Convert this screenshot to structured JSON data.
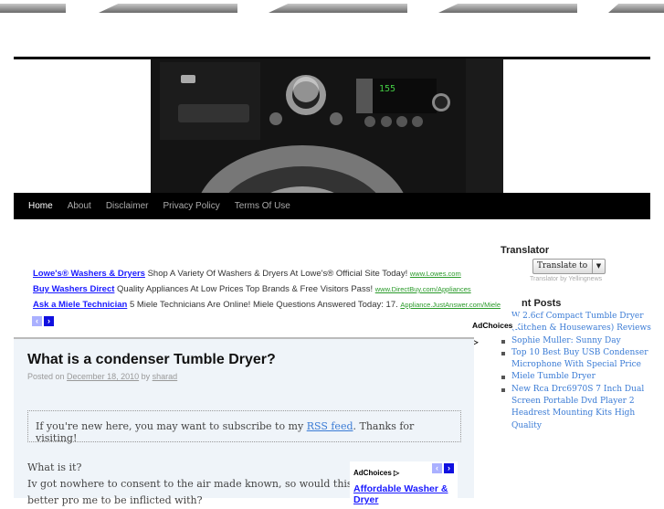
{
  "nav": {
    "items": [
      "Home",
      "About",
      "Disclaimer",
      "Privacy Policy",
      "Terms Of Use"
    ],
    "active": 0
  },
  "ads": [
    {
      "title": "Lowe's® Washers & Dryers",
      "text": "Shop A Variety Of Washers & Dryers At Lowe's® Official Site Today!",
      "url": "www.Lowes.com"
    },
    {
      "title": "Buy Washers Direct",
      "text": "Quality Appliances At Low Prices Top Brands & Free Visitors Pass!",
      "url": "www.DirectBuy.com/Appliances"
    },
    {
      "title": "Ask a Miele Technician",
      "text": "5 Miele Technicians Are Online! Miele Questions Answered Today: 17.",
      "url": "Appliance.JustAnswer.com/Miele"
    }
  ],
  "adchoices": "AdChoices ▷",
  "post": {
    "title": "What is a condenser Tumble Dryer?",
    "posted_on": "Posted on",
    "date": "December 18, 2010",
    "by": "by",
    "author": "sharad",
    "rss_pre": "If you're new here, you may want to subscribe to my",
    "rss_link": "RSS feed",
    "rss_post": ". Thanks for visiting!",
    "body": [
      "What is it?",
      "Iv got nowhere to consent to the air made known, so would this be",
      "better pro me to be inflicted with?"
    ]
  },
  "inline_ad": {
    "adchoices": "AdChoices ▷",
    "title": "Affordable Washer & Dryer"
  },
  "sidebar": {
    "translator_title": "Translator",
    "translate_select": "Translate to",
    "translator_credit": "Translator by Yellingnews",
    "recent_title": "Recent Posts",
    "recent_visible_title": "nt Posts",
    "recent": [
      "W 2.6cf Compact Tumble Dryer (Kitchen & Housewares) Reviews",
      "Sophie Muller: Sunny Day",
      "Top 10 Best Buy USB Condenser Microphone With Special Price",
      "Miele Tumble Dryer",
      "New Rca Drc6970S 7 Inch Dual Screen Portable Dvd Player 2 Headrest Mounting Kits High Quality"
    ]
  },
  "colors": {
    "link": "#3a7bd5",
    "ad_link": "#1a1aff",
    "ad_url": "#2a9a2a",
    "nav_bg": "#000000",
    "content_bg": "#eff4f9"
  }
}
